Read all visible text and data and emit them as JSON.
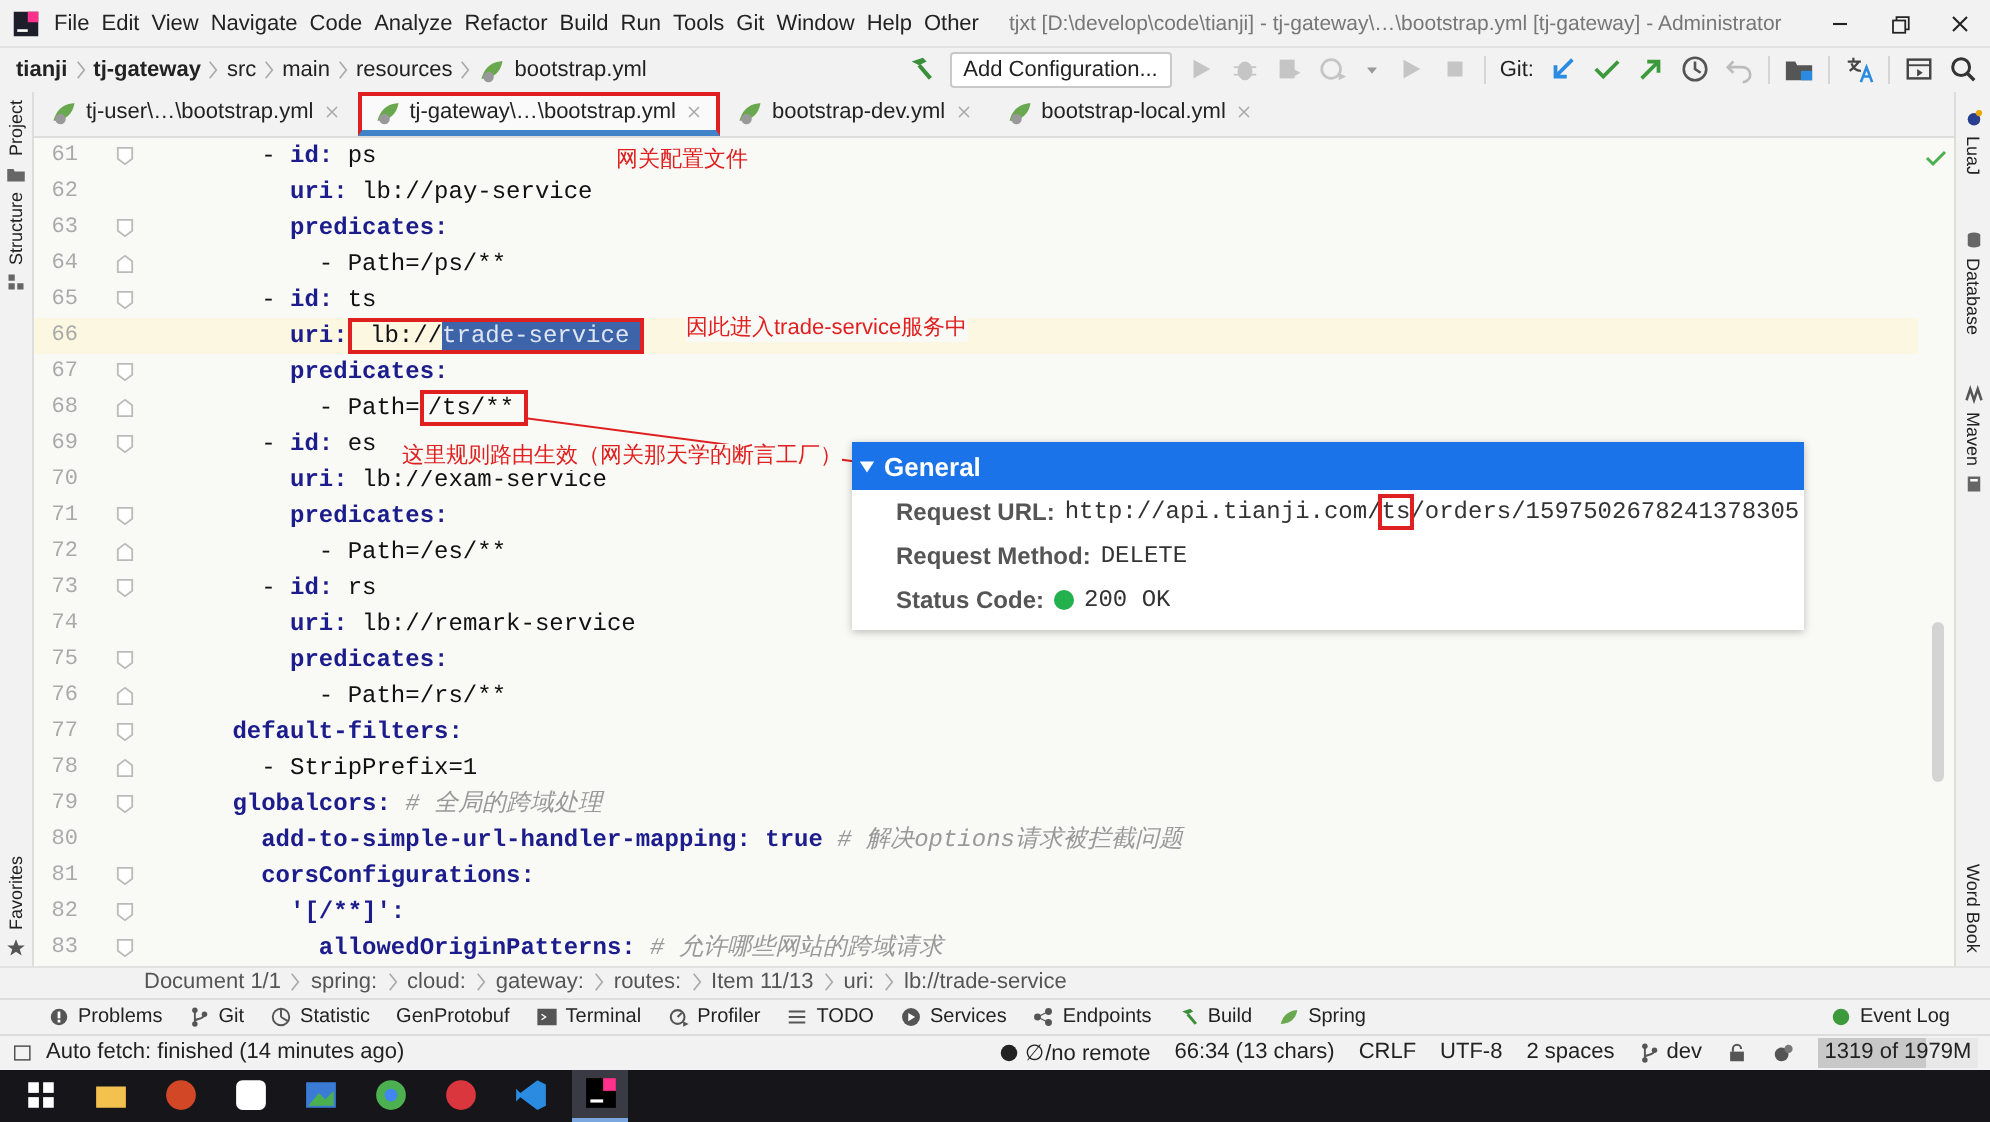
{
  "menu": [
    "File",
    "Edit",
    "View",
    "Navigate",
    "Code",
    "Analyze",
    "Refactor",
    "Build",
    "Run",
    "Tools",
    "Git",
    "Window",
    "Help",
    "Other"
  ],
  "window": {
    "title": "tjxt [D:\\develop\\code\\tianji] - tj-gateway\\…\\bootstrap.yml [tj-gateway] - Administrator"
  },
  "breadcrumb": [
    {
      "text": "tianji",
      "bold": true
    },
    {
      "text": "tj-gateway",
      "bold": true
    },
    {
      "text": "src",
      "bold": false
    },
    {
      "text": "main",
      "bold": false
    },
    {
      "text": "resources",
      "bold": false
    },
    {
      "text": "bootstrap.yml",
      "bold": false
    }
  ],
  "toolbar": {
    "run_config": "Add Configuration...",
    "git_label": "Git:"
  },
  "tabs": [
    {
      "label": "tj-user\\…\\bootstrap.yml",
      "selected": false,
      "highlighted": false
    },
    {
      "label": "tj-gateway\\…\\bootstrap.yml",
      "selected": true,
      "highlighted": true
    },
    {
      "label": "bootstrap-dev.yml",
      "selected": false,
      "highlighted": false
    },
    {
      "label": "bootstrap-local.yml",
      "selected": false,
      "highlighted": false
    }
  ],
  "left_strip": {
    "top": [
      "Project",
      "Structure"
    ],
    "bottom": [
      "Favorites"
    ]
  },
  "right_strip": [
    "LuaJ",
    "Database",
    "Maven",
    "Word Book"
  ],
  "lines": [
    {
      "n": "61",
      "fold_start": true,
      "fold_end": false,
      "current": false,
      "tokens": [
        {
          "kind": "plain",
          "text": "        - "
        },
        {
          "kind": "key",
          "text": "id:"
        },
        {
          "kind": "plain",
          "text": " ps"
        }
      ]
    },
    {
      "n": "62",
      "fold_start": false,
      "fold_end": false,
      "current": false,
      "tokens": [
        {
          "kind": "key",
          "text": "          uri:"
        },
        {
          "kind": "plain",
          "text": " lb://pay-service"
        }
      ]
    },
    {
      "n": "63",
      "fold_start": true,
      "fold_end": false,
      "current": false,
      "tokens": [
        {
          "kind": "key",
          "text": "          predicates:"
        }
      ]
    },
    {
      "n": "64",
      "fold_start": false,
      "fold_end": true,
      "current": false,
      "tokens": [
        {
          "kind": "plain",
          "text": "            - Path=/ps/**"
        }
      ]
    },
    {
      "n": "65",
      "fold_start": true,
      "fold_end": false,
      "current": false,
      "tokens": [
        {
          "kind": "plain",
          "text": "        - "
        },
        {
          "kind": "key",
          "text": "id:"
        },
        {
          "kind": "plain",
          "text": " ts"
        }
      ]
    },
    {
      "n": "66",
      "fold_start": false,
      "fold_end": false,
      "current": true,
      "tokens": [
        {
          "kind": "key",
          "text": "          uri:"
        },
        {
          "kind": "plain",
          "text": " lb://",
          "boxed": true
        },
        {
          "kind": "plain",
          "text": "trade-service",
          "selected": true,
          "boxed": true
        }
      ]
    },
    {
      "n": "67",
      "fold_start": true,
      "fold_end": false,
      "current": false,
      "tokens": [
        {
          "kind": "key",
          "text": "          predicates:"
        }
      ]
    },
    {
      "n": "68",
      "fold_start": false,
      "fold_end": true,
      "current": false,
      "tokens": [
        {
          "kind": "plain",
          "text": "            - Path="
        },
        {
          "kind": "plain",
          "text": "/ts/**",
          "boxed": true
        }
      ]
    },
    {
      "n": "69",
      "fold_start": true,
      "fold_end": false,
      "current": false,
      "tokens": [
        {
          "kind": "plain",
          "text": "        - "
        },
        {
          "kind": "key",
          "text": "id:"
        },
        {
          "kind": "plain",
          "text": " es"
        }
      ]
    },
    {
      "n": "70",
      "fold_start": false,
      "fold_end": false,
      "current": false,
      "tokens": [
        {
          "kind": "key",
          "text": "          uri:"
        },
        {
          "kind": "plain",
          "text": " lb://exam-service"
        }
      ]
    },
    {
      "n": "71",
      "fold_start": true,
      "fold_end": false,
      "current": false,
      "tokens": [
        {
          "kind": "key",
          "text": "          predicates:"
        }
      ]
    },
    {
      "n": "72",
      "fold_start": false,
      "fold_end": true,
      "current": false,
      "tokens": [
        {
          "kind": "plain",
          "text": "            - Path=/es/**"
        }
      ]
    },
    {
      "n": "73",
      "fold_start": true,
      "fold_end": false,
      "current": false,
      "tokens": [
        {
          "kind": "plain",
          "text": "        - "
        },
        {
          "kind": "key",
          "text": "id:"
        },
        {
          "kind": "plain",
          "text": " rs"
        }
      ]
    },
    {
      "n": "74",
      "fold_start": false,
      "fold_end": false,
      "current": false,
      "tokens": [
        {
          "kind": "key",
          "text": "          uri:"
        },
        {
          "kind": "plain",
          "text": " lb://remark-service"
        }
      ]
    },
    {
      "n": "75",
      "fold_start": true,
      "fold_end": false,
      "current": false,
      "tokens": [
        {
          "kind": "key",
          "text": "          predicates:"
        }
      ]
    },
    {
      "n": "76",
      "fold_start": false,
      "fold_end": true,
      "current": false,
      "tokens": [
        {
          "kind": "plain",
          "text": "            - Path=/rs/**"
        }
      ]
    },
    {
      "n": "77",
      "fold_start": true,
      "fold_end": false,
      "current": false,
      "tokens": [
        {
          "kind": "key",
          "text": "      default-filters:"
        }
      ]
    },
    {
      "n": "78",
      "fold_start": false,
      "fold_end": true,
      "current": false,
      "tokens": [
        {
          "kind": "plain",
          "text": "        - StripPrefix=1"
        }
      ]
    },
    {
      "n": "79",
      "fold_start": true,
      "fold_end": false,
      "current": false,
      "tokens": [
        {
          "kind": "key",
          "text": "      globalcors:"
        },
        {
          "kind": "comment",
          "text": " # 全局的跨域处理"
        }
      ]
    },
    {
      "n": "80",
      "fold_start": false,
      "fold_end": false,
      "current": false,
      "tokens": [
        {
          "kind": "key",
          "text": "        add-to-simple-url-handler-mapping:"
        },
        {
          "kind": "bool",
          "text": " true"
        },
        {
          "kind": "comment",
          "text": " # 解决options请求被拦截问题"
        }
      ]
    },
    {
      "n": "81",
      "fold_start": true,
      "fold_end": false,
      "current": false,
      "tokens": [
        {
          "kind": "key",
          "text": "        corsConfigurations:"
        }
      ]
    },
    {
      "n": "82",
      "fold_start": true,
      "fold_end": false,
      "current": false,
      "tokens": [
        {
          "kind": "key",
          "text": "          '[/**]':"
        }
      ]
    },
    {
      "n": "83",
      "fold_start": true,
      "fold_end": false,
      "current": false,
      "tokens": [
        {
          "kind": "key",
          "text": "            allowedOriginPatterns:"
        },
        {
          "kind": "comment",
          "text": " # 允许哪些网站的跨域请求"
        }
      ]
    }
  ],
  "annotations": [
    {
      "text": "网关配置文件"
    },
    {
      "text": "因此进入trade-service服务中"
    },
    {
      "text": "这里规则路由生效（网关那天学的断言工厂）"
    }
  ],
  "request_panel": {
    "title": "General",
    "expanded": true,
    "rows": [
      {
        "kind": "url",
        "label": "Request URL:",
        "parts": [
          {
            "text": "http://api.tianji.com/",
            "boxed": false
          },
          {
            "text": "ts",
            "boxed": true
          },
          {
            "text": "/orders/1597502678241378305",
            "boxed": false
          }
        ]
      },
      {
        "kind": "text",
        "label": "Request Method:",
        "value": "DELETE"
      },
      {
        "kind": "status",
        "label": "Status Code:",
        "value": "200 OK",
        "color": "#22b14c"
      }
    ]
  },
  "path_bar": [
    "Document 1/1",
    "spring:",
    "cloud:",
    "gateway:",
    "routes:",
    "Item 11/13",
    "uri:",
    "lb://trade-service"
  ],
  "tool_windows": [
    "Problems",
    "Git",
    "Statistic",
    "GenProtobuf",
    "Terminal",
    "Profiler",
    "TODO",
    "Services",
    "Endpoints",
    "Build",
    "Spring"
  ],
  "event_log": "Event Log",
  "status_bar": {
    "message": "Auto fetch: finished (14 minutes ago)",
    "items": [
      "∅/no remote",
      "66:34 (13 chars)",
      "CRLF",
      "UTF-8",
      "2 spaces",
      "dev"
    ],
    "memory": {
      "text": "1319 of 1979M",
      "level": 0.67
    }
  },
  "taskbar": [
    {
      "selected": false
    },
    {
      "selected": false
    },
    {
      "selected": false
    },
    {
      "selected": false
    },
    {
      "selected": false
    },
    {
      "selected": false
    },
    {
      "selected": false
    },
    {
      "selected": false
    },
    {
      "selected": true
    }
  ]
}
